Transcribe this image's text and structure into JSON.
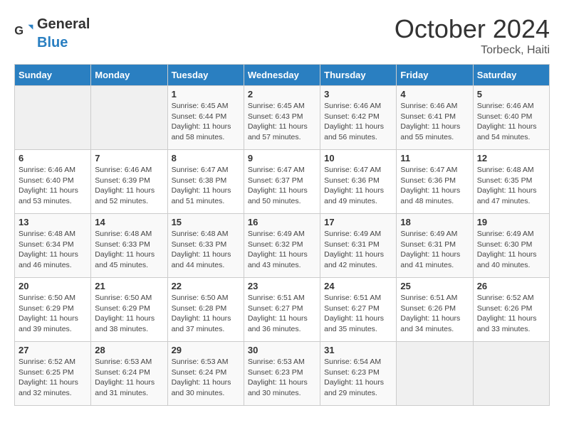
{
  "header": {
    "logo_general": "General",
    "logo_blue": "Blue",
    "month_title": "October 2024",
    "location": "Torbeck, Haiti"
  },
  "days_of_week": [
    "Sunday",
    "Monday",
    "Tuesday",
    "Wednesday",
    "Thursday",
    "Friday",
    "Saturday"
  ],
  "weeks": [
    [
      {
        "day": "",
        "info": ""
      },
      {
        "day": "",
        "info": ""
      },
      {
        "day": "1",
        "info": "Sunrise: 6:45 AM\nSunset: 6:44 PM\nDaylight: 11 hours and 58 minutes."
      },
      {
        "day": "2",
        "info": "Sunrise: 6:45 AM\nSunset: 6:43 PM\nDaylight: 11 hours and 57 minutes."
      },
      {
        "day": "3",
        "info": "Sunrise: 6:46 AM\nSunset: 6:42 PM\nDaylight: 11 hours and 56 minutes."
      },
      {
        "day": "4",
        "info": "Sunrise: 6:46 AM\nSunset: 6:41 PM\nDaylight: 11 hours and 55 minutes."
      },
      {
        "day": "5",
        "info": "Sunrise: 6:46 AM\nSunset: 6:40 PM\nDaylight: 11 hours and 54 minutes."
      }
    ],
    [
      {
        "day": "6",
        "info": "Sunrise: 6:46 AM\nSunset: 6:40 PM\nDaylight: 11 hours and 53 minutes."
      },
      {
        "day": "7",
        "info": "Sunrise: 6:46 AM\nSunset: 6:39 PM\nDaylight: 11 hours and 52 minutes."
      },
      {
        "day": "8",
        "info": "Sunrise: 6:47 AM\nSunset: 6:38 PM\nDaylight: 11 hours and 51 minutes."
      },
      {
        "day": "9",
        "info": "Sunrise: 6:47 AM\nSunset: 6:37 PM\nDaylight: 11 hours and 50 minutes."
      },
      {
        "day": "10",
        "info": "Sunrise: 6:47 AM\nSunset: 6:36 PM\nDaylight: 11 hours and 49 minutes."
      },
      {
        "day": "11",
        "info": "Sunrise: 6:47 AM\nSunset: 6:36 PM\nDaylight: 11 hours and 48 minutes."
      },
      {
        "day": "12",
        "info": "Sunrise: 6:48 AM\nSunset: 6:35 PM\nDaylight: 11 hours and 47 minutes."
      }
    ],
    [
      {
        "day": "13",
        "info": "Sunrise: 6:48 AM\nSunset: 6:34 PM\nDaylight: 11 hours and 46 minutes."
      },
      {
        "day": "14",
        "info": "Sunrise: 6:48 AM\nSunset: 6:33 PM\nDaylight: 11 hours and 45 minutes."
      },
      {
        "day": "15",
        "info": "Sunrise: 6:48 AM\nSunset: 6:33 PM\nDaylight: 11 hours and 44 minutes."
      },
      {
        "day": "16",
        "info": "Sunrise: 6:49 AM\nSunset: 6:32 PM\nDaylight: 11 hours and 43 minutes."
      },
      {
        "day": "17",
        "info": "Sunrise: 6:49 AM\nSunset: 6:31 PM\nDaylight: 11 hours and 42 minutes."
      },
      {
        "day": "18",
        "info": "Sunrise: 6:49 AM\nSunset: 6:31 PM\nDaylight: 11 hours and 41 minutes."
      },
      {
        "day": "19",
        "info": "Sunrise: 6:49 AM\nSunset: 6:30 PM\nDaylight: 11 hours and 40 minutes."
      }
    ],
    [
      {
        "day": "20",
        "info": "Sunrise: 6:50 AM\nSunset: 6:29 PM\nDaylight: 11 hours and 39 minutes."
      },
      {
        "day": "21",
        "info": "Sunrise: 6:50 AM\nSunset: 6:29 PM\nDaylight: 11 hours and 38 minutes."
      },
      {
        "day": "22",
        "info": "Sunrise: 6:50 AM\nSunset: 6:28 PM\nDaylight: 11 hours and 37 minutes."
      },
      {
        "day": "23",
        "info": "Sunrise: 6:51 AM\nSunset: 6:27 PM\nDaylight: 11 hours and 36 minutes."
      },
      {
        "day": "24",
        "info": "Sunrise: 6:51 AM\nSunset: 6:27 PM\nDaylight: 11 hours and 35 minutes."
      },
      {
        "day": "25",
        "info": "Sunrise: 6:51 AM\nSunset: 6:26 PM\nDaylight: 11 hours and 34 minutes."
      },
      {
        "day": "26",
        "info": "Sunrise: 6:52 AM\nSunset: 6:26 PM\nDaylight: 11 hours and 33 minutes."
      }
    ],
    [
      {
        "day": "27",
        "info": "Sunrise: 6:52 AM\nSunset: 6:25 PM\nDaylight: 11 hours and 32 minutes."
      },
      {
        "day": "28",
        "info": "Sunrise: 6:53 AM\nSunset: 6:24 PM\nDaylight: 11 hours and 31 minutes."
      },
      {
        "day": "29",
        "info": "Sunrise: 6:53 AM\nSunset: 6:24 PM\nDaylight: 11 hours and 30 minutes."
      },
      {
        "day": "30",
        "info": "Sunrise: 6:53 AM\nSunset: 6:23 PM\nDaylight: 11 hours and 30 minutes."
      },
      {
        "day": "31",
        "info": "Sunrise: 6:54 AM\nSunset: 6:23 PM\nDaylight: 11 hours and 29 minutes."
      },
      {
        "day": "",
        "info": ""
      },
      {
        "day": "",
        "info": ""
      }
    ]
  ]
}
